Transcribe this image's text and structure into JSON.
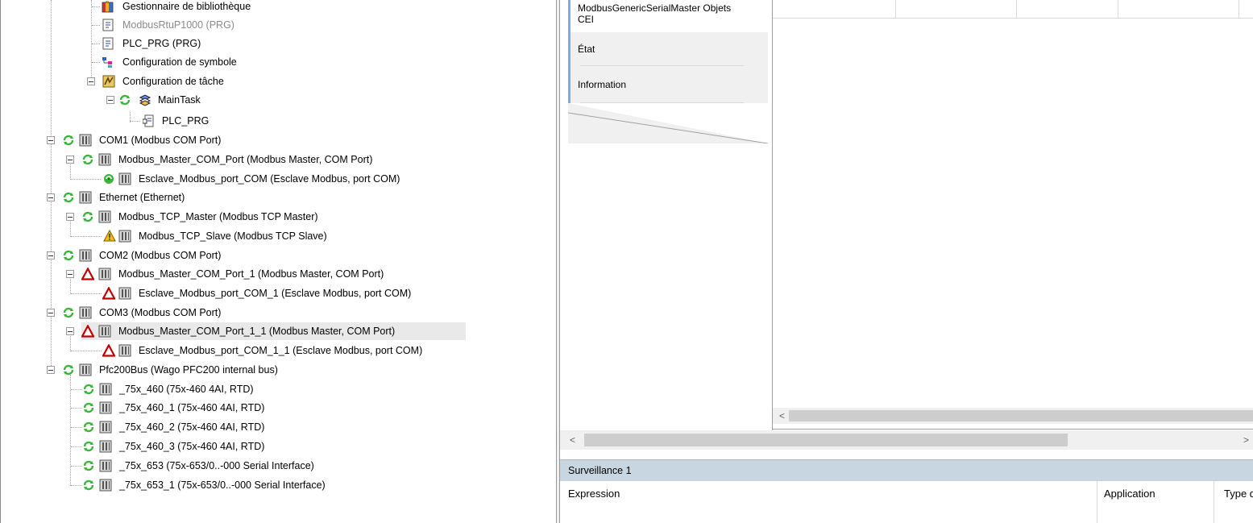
{
  "tree": {
    "items": [
      {
        "label": "Gestionnaire de bibliothèque",
        "muted": false
      },
      {
        "label": "ModbusRtuP1000 (PRG)",
        "muted": true
      },
      {
        "label": "PLC_PRG (PRG)",
        "muted": false
      },
      {
        "label": "Configuration de symbole",
        "muted": false
      },
      {
        "label": "Configuration de tâche",
        "muted": false
      },
      {
        "label": "MainTask",
        "muted": false
      },
      {
        "label": "PLC_PRG",
        "muted": false
      },
      {
        "label": "COM1 (Modbus COM Port)",
        "muted": false
      },
      {
        "label": "Modbus_Master_COM_Port (Modbus Master, COM Port)",
        "muted": false
      },
      {
        "label": "Esclave_Modbus_port_COM (Esclave Modbus, port COM)",
        "muted": false
      },
      {
        "label": "Ethernet (Ethernet)",
        "muted": false
      },
      {
        "label": "Modbus_TCP_Master (Modbus TCP Master)",
        "muted": false
      },
      {
        "label": "Modbus_TCP_Slave (Modbus TCP Slave)",
        "muted": false
      },
      {
        "label": "COM2 (Modbus COM Port)",
        "muted": false
      },
      {
        "label": "Modbus_Master_COM_Port_1 (Modbus Master, COM Port)",
        "muted": false
      },
      {
        "label": "Esclave_Modbus_port_COM_1 (Esclave Modbus, port COM)",
        "muted": false
      },
      {
        "label": "COM3 (Modbus COM Port)",
        "muted": false
      },
      {
        "label": "Modbus_Master_COM_Port_1_1 (Modbus Master, COM Port)",
        "muted": false
      },
      {
        "label": "Esclave_Modbus_port_COM_1_1 (Esclave Modbus, port COM)",
        "muted": false
      },
      {
        "label": "Pfc200Bus (Wago PFC200 internal bus)",
        "muted": false
      },
      {
        "label": "_75x_460 (75x-460 4AI, RTD)",
        "muted": false
      },
      {
        "label": "_75x_460_1 (75x-460 4AI, RTD)",
        "muted": false
      },
      {
        "label": "_75x_460_2 (75x-460 4AI, RTD)",
        "muted": false
      },
      {
        "label": "_75x_460_3 (75x-460 4AI, RTD)",
        "muted": false
      },
      {
        "label": "_75x_653 (75x-653/0..-000 Serial Interface)",
        "muted": false
      },
      {
        "label": "_75x_653_1 (75x-653/0..-000 Serial Interface)",
        "muted": false
      }
    ],
    "selected_item": "Modbus_Master_COM_Port_1_1 (Modbus Master, COM Port)"
  },
  "editor": {
    "tabs": [
      {
        "label_line1": "ModbusGenericSerialMaster Objets",
        "label_line2": "CEI"
      },
      {
        "label_line1": "État",
        "label_line2": ""
      },
      {
        "label_line1": "Information",
        "label_line2": ""
      }
    ],
    "active_tab": "ModbusGenericSerialMaster Objets CEI",
    "scroll_left_arrow": "<",
    "scroll_right_arrow": ">"
  },
  "watch": {
    "title": "Surveillance 1",
    "columns": [
      "Expression",
      "Application",
      "Type d"
    ]
  },
  "colors": {
    "accent_tab": "#78aee0",
    "watch_header_bg": "#c8d6e2",
    "error_red": "#c00000",
    "warning_yellow": "#f2c200",
    "sync_green": "#3cb43c"
  }
}
